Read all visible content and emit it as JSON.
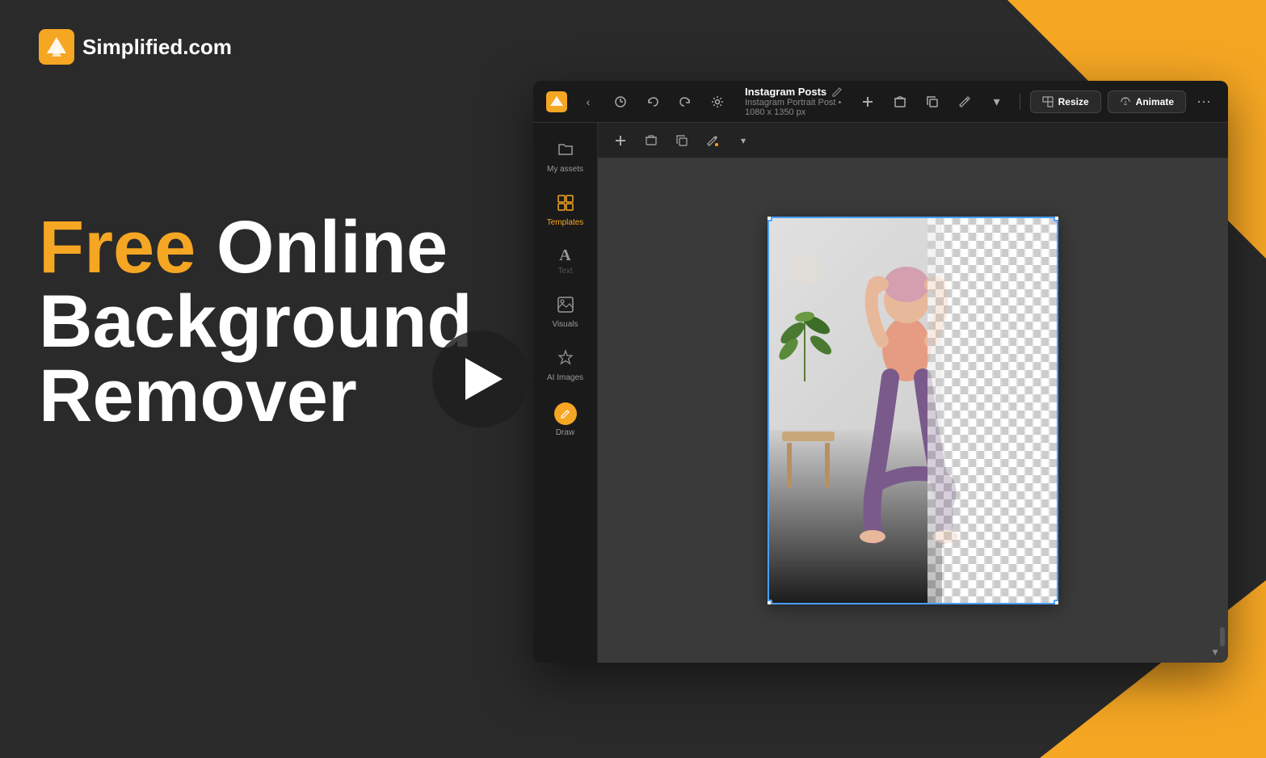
{
  "brand": {
    "name": "Simplified.com",
    "logo_icon": "⚡"
  },
  "hero": {
    "line1_free": "Free",
    "line1_rest": " Online",
    "line2": "Background",
    "line3": "Remover"
  },
  "toolbar": {
    "title": "Instagram Posts",
    "subtitle": "Instagram Portrait Post • 1080 x 1350 px",
    "buttons": {
      "resize": "Resize",
      "animate": "Animate",
      "more": "···"
    },
    "icons": {
      "back": "‹",
      "history": "🕐",
      "undo": "↩",
      "redo": "↪",
      "settings": "⚙"
    }
  },
  "sidebar": {
    "items": [
      {
        "id": "my-assets",
        "label": "My assets",
        "icon": "📁"
      },
      {
        "id": "templates",
        "label": "Templates",
        "icon": "⊞"
      },
      {
        "id": "text",
        "label": "Text",
        "icon": "A"
      },
      {
        "id": "visuals",
        "label": "Visuals",
        "icon": "🖼"
      },
      {
        "id": "ai-images",
        "label": "AI Images",
        "icon": "✨"
      },
      {
        "id": "draw",
        "label": "Draw",
        "icon": "✏"
      }
    ]
  },
  "canvas_toolbar": {
    "icons": [
      "＋",
      "🗑",
      "⧉",
      "🪣",
      "▾"
    ]
  },
  "play_button": {
    "label": "Play video"
  },
  "colors": {
    "accent": "#f5a623",
    "dark_bg": "#2a2a2a",
    "toolbar_bg": "#1a1a1a",
    "sidebar_bg": "#1a1a1a"
  }
}
